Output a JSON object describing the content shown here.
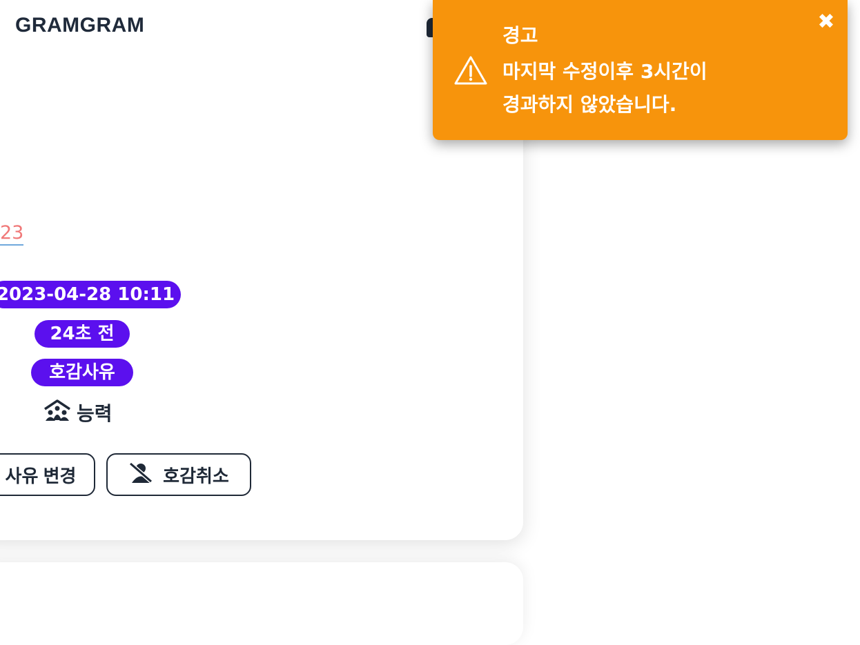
{
  "header": {
    "brand": "GRAMGRAM"
  },
  "post": {
    "link_fragment": "23",
    "date": "2023-04-28 10:11",
    "elapsed": "24초 전",
    "reason_badge": "호감사유",
    "ability_label": "능력",
    "ability_icon": "group-house-icon"
  },
  "actions": {
    "change_reason": {
      "label": "사유 변경"
    },
    "cancel_like": {
      "label": "호감취소",
      "icon": "user-slash-icon"
    }
  },
  "toast": {
    "title": "경고",
    "message_line1": "마지막 수정이후 3시간이",
    "message_line2": "경과하지 않았습니다.",
    "icon": "warning-icon",
    "close_icon": "close-icon",
    "color": "#f7940c"
  },
  "colors": {
    "badge": "#5b10ee",
    "link": "#f07878"
  }
}
